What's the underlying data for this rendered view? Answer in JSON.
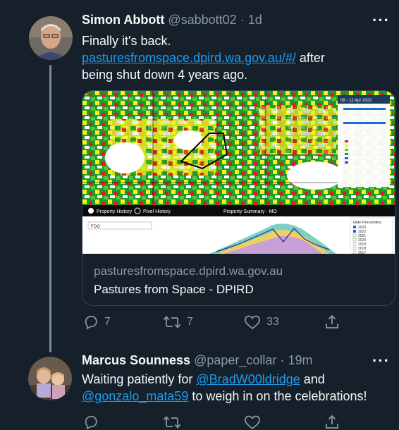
{
  "tweets": [
    {
      "name": "Simon Abbott",
      "handle": "@sabbott02",
      "separator": "·",
      "time": "1d",
      "more": "···",
      "text_line1": "Finally it's back.",
      "link": "pasturesfromspace.dpird.wa.gov.au/#/",
      "text_after_link": " after",
      "text_line3": "being shut down 4 years ago.",
      "card": {
        "domain": "pasturesfromspace.dpird.wa.gov.au",
        "title": "Pastures from Space - DPIRD",
        "image_text": {
          "property_history": "Property History",
          "pixel_history": "Pixel History",
          "property_summary": "Property Summary - MO",
          "dropdown": "FOO",
          "panel_title": "Hide Percentiles",
          "date_range": "08 - 12 Apr 2022",
          "legend_years": [
            "2023",
            "2022",
            "2021",
            "2020",
            "2019",
            "2018",
            "2017"
          ]
        }
      },
      "stats": {
        "replies": "7",
        "retweets": "7",
        "likes": "33"
      }
    },
    {
      "name": "Marcus Sounness",
      "handle": "@paper_collar",
      "separator": "·",
      "time": "19m",
      "more": "···",
      "text_before_mention1": "Waiting patiently for ",
      "mention1": "@BradW00ldridge",
      "text_after_mention1": " and",
      "mention2": "@gonzalo_mata59",
      "text_after_mention2": " to weigh in on the celebrations!"
    }
  ],
  "colors": {
    "background": "#15202b",
    "link": "#1d9bf0",
    "muted": "#8b98a5",
    "thread": "#7d8b99"
  }
}
